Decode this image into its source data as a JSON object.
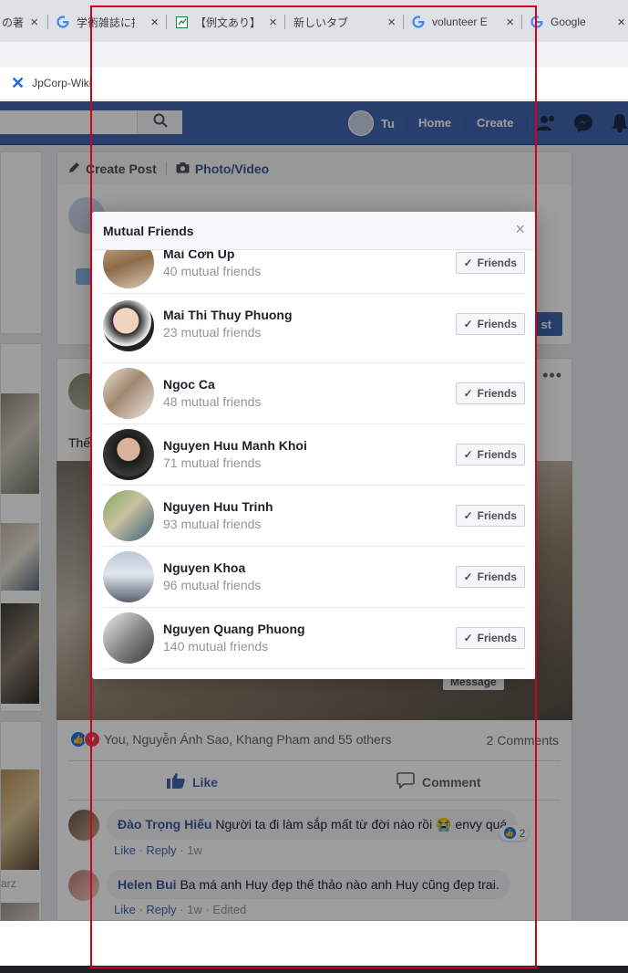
{
  "browser": {
    "tabs": [
      {
        "label": "の著",
        "icon": "doc-icon"
      },
      {
        "label": "学術雑誌に掲",
        "icon": "google-g-icon"
      },
      {
        "label": "【例文あり】願",
        "icon": "sheet-icon"
      },
      {
        "label": "新しいタブ",
        "icon": ""
      },
      {
        "label": "volunteer E",
        "icon": "google-g-icon"
      },
      {
        "label": "Google",
        "icon": "google-g-icon"
      }
    ],
    "bookmark": "JpCorp-Wiki"
  },
  "fb": {
    "user": "Tu",
    "nav_home": "Home",
    "nav_create": "Create",
    "create_post": "Create Post",
    "photo_video": "Photo/Video",
    "post_text_fragment": "Thế",
    "post_button": "st",
    "message_chip": "Message",
    "reactions_text": "You, Nguyễn Ánh Sao, Khang Pham and 55 others",
    "comments_count": "2 Comments",
    "like_label": "Like",
    "comment_label": "Comment",
    "left_text": "arz",
    "comments": [
      {
        "author": "Đào Trọng Hiếu",
        "text": "Người ta đi làm sắp mất từ đời nào rồi 😭 envy quá",
        "actions": {
          "like": "Like",
          "reply": "Reply",
          "time": "1w",
          "edited": ""
        },
        "reaction_count": "2"
      },
      {
        "author": "Helen Bui",
        "text": "Ba má anh Huy đẹp thế thảo nào anh Huy cũng đẹp trai.",
        "actions": {
          "like": "Like",
          "reply": "Reply",
          "time": "1w",
          "edited": "Edited"
        },
        "reaction_count": ""
      }
    ]
  },
  "modal": {
    "title": "Mutual Friends",
    "close_symbol": "×",
    "friend_button": "Friends",
    "friends": [
      {
        "name": "Mai Cơn Up",
        "mutual": "40 mutual friends"
      },
      {
        "name": "Mai Thi Thuy Phuong",
        "mutual": "23 mutual friends"
      },
      {
        "name": "Ngoc Ca",
        "mutual": "48 mutual friends"
      },
      {
        "name": "Nguyen Huu Manh Khoi",
        "mutual": "71 mutual friends"
      },
      {
        "name": "Nguyen Huu Trinh",
        "mutual": "93 mutual friends"
      },
      {
        "name": "Nguyen Khoa",
        "mutual": "96 mutual friends"
      },
      {
        "name": "Nguyen Quang Phuong",
        "mutual": "140 mutual friends"
      }
    ]
  },
  "colors": {
    "fb_blue": "#4267b2",
    "highlight_frame": "#d0021b"
  }
}
